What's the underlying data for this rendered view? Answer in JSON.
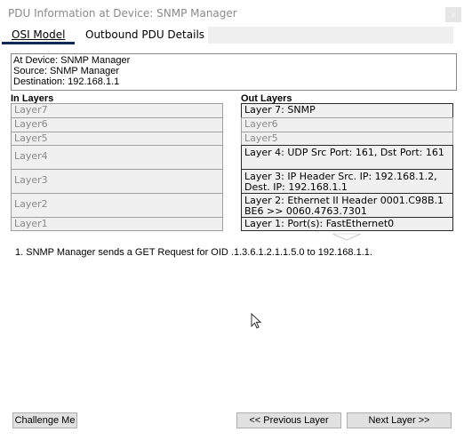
{
  "window": {
    "title": "PDU Information at Device: SNMP Manager",
    "close_label": "x"
  },
  "tabs": [
    {
      "label": "OSI Model",
      "active": true
    },
    {
      "label": "Outbound PDU Details",
      "active": false
    }
  ],
  "info": {
    "at_device": "At Device: SNMP Manager",
    "source": "Source: SNMP Manager",
    "destination": "Destination: 192.168.1.1"
  },
  "in_layers": {
    "header": "In Layers",
    "items": [
      {
        "label": "Layer7",
        "active": false
      },
      {
        "label": "Layer6",
        "active": false
      },
      {
        "label": "Layer5",
        "active": false
      },
      {
        "label": "Layer4",
        "active": false
      },
      {
        "label": "Layer3",
        "active": false
      },
      {
        "label": "Layer2",
        "active": false
      },
      {
        "label": "Layer1",
        "active": false
      }
    ]
  },
  "out_layers": {
    "header": "Out Layers",
    "items": [
      {
        "label": "Layer 7: SNMP",
        "active": true
      },
      {
        "label": "Layer6",
        "active": false
      },
      {
        "label": "Layer5",
        "active": false
      },
      {
        "label": "Layer 4: UDP Src Port: 161, Dst Port: 161",
        "active": true
      },
      {
        "label": "Layer 3: IP Header Src. IP: 192.168.1.2, Dest. IP: 192.168.1.1",
        "active": true
      },
      {
        "label": "Layer 2: Ethernet II Header 0001.C98B.1BE6 >> 0060.4763.7301",
        "active": true
      },
      {
        "label": "Layer 1: Port(s): FastEthernet0",
        "active": true
      }
    ]
  },
  "message": "1. SNMP Manager sends a GET Request for OID .1.3.6.1.2.1.1.5.0 to 192.168.1.1.",
  "buttons": {
    "challenge": "Challenge Me",
    "previous": "<< Previous Layer",
    "next": "Next Layer >>"
  }
}
